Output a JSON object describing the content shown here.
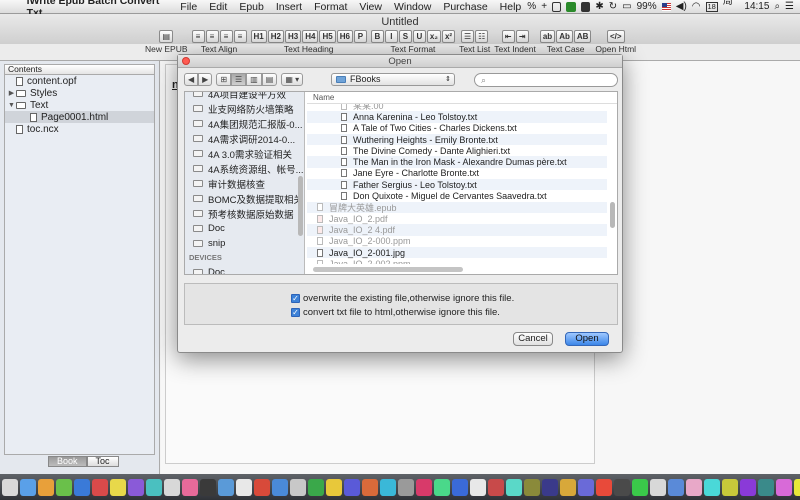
{
  "menubar": {
    "app_name": "iWrite Epub Batch Convert Txt",
    "items": [
      "File",
      "Edit",
      "Epub",
      "Insert",
      "Format",
      "View",
      "Window",
      "Purchase",
      "Help"
    ],
    "battery": "99%",
    "cal_day": "18",
    "weekday": "周一",
    "time": "14:15"
  },
  "window": {
    "title": "Untitled",
    "toolbar": [
      {
        "label": "New EPUB",
        "buttons": [
          "▤"
        ]
      },
      {
        "label": "Text Align",
        "buttons": [
          "≡",
          "≡",
          "≡",
          "≡"
        ]
      },
      {
        "label": "Text Heading",
        "buttons": [
          "H1",
          "H2",
          "H3",
          "H4",
          "H5",
          "H6",
          "P"
        ]
      },
      {
        "label": "Text Format",
        "buttons": [
          "B",
          "I",
          "S",
          "U",
          "x₂",
          "x²"
        ]
      },
      {
        "label": "Text List",
        "buttons": [
          "☰",
          "☷"
        ]
      },
      {
        "label": "Text Indent",
        "buttons": [
          "⇤",
          "⇥"
        ]
      },
      {
        "label": "Text Case",
        "buttons": [
          "ab",
          "Ab",
          "AB"
        ]
      },
      {
        "label": "Open Html",
        "buttons": [
          "</>"
        ]
      }
    ]
  },
  "sidebar": {
    "header": "Contents",
    "items": [
      {
        "label": "content.opf",
        "level": 0,
        "type": "file",
        "expand": ""
      },
      {
        "label": "Styles",
        "level": 0,
        "type": "folder",
        "expand": "▶"
      },
      {
        "label": "Text",
        "level": 0,
        "type": "folder",
        "expand": "▼"
      },
      {
        "label": "Page0001.html",
        "level": 1,
        "type": "file",
        "expand": "",
        "selected": true
      },
      {
        "label": "toc.ncx",
        "level": 0,
        "type": "file",
        "expand": ""
      }
    ],
    "tabs": [
      "Book",
      "Toc"
    ]
  },
  "editor": {
    "visible_text": "ne"
  },
  "dialog": {
    "title": "Open",
    "location": "FBooks",
    "nav_back": "◀",
    "nav_forward": "▶",
    "view_buttons": [
      "⊞",
      "☰",
      "▥",
      "▤"
    ],
    "arrange_button": "▦ ▾",
    "favorites": [
      "4A项目建设平方效",
      "业支网络防火墙策略",
      "4A集团规范汇报版-0...",
      "4A需求调研2014-0...",
      "4A 3.0需求验证相关",
      "4A系统资源组、帐号...",
      "审计数据核查",
      "BOMC及数据提取相关",
      "预考核数据原始数据",
      "Doc",
      "snip"
    ],
    "devices_header": "DEVICES",
    "devices": [
      "Doc"
    ],
    "column_header": "Name",
    "files": [
      {
        "name": "某某.00",
        "indent": true,
        "dim": true
      },
      {
        "name": "Anna Karenina - Leo Tolstoy.txt",
        "indent": true,
        "dim": false
      },
      {
        "name": "A Tale of Two Cities - Charles Dickens.txt",
        "indent": true,
        "dim": false
      },
      {
        "name": "Wuthering Heights - Emily Bronte.txt",
        "indent": true,
        "dim": false
      },
      {
        "name": "The Divine Comedy - Dante Alighieri.txt",
        "indent": true,
        "dim": false
      },
      {
        "name": "The Man in the Iron Mask - Alexandre Dumas père.txt",
        "indent": true,
        "dim": false
      },
      {
        "name": "Jane Eyre - Charlotte Bronte.txt",
        "indent": true,
        "dim": false
      },
      {
        "name": "Father Sergius - Leo Tolstoy.txt",
        "indent": true,
        "dim": false
      },
      {
        "name": "Don Quixote - Miguel de Cervantes Saavedra.txt",
        "indent": true,
        "dim": false
      },
      {
        "name": "冒牌大英雄.epub",
        "indent": false,
        "dim": true
      },
      {
        "name": "Java_IO_2.pdf",
        "indent": false,
        "dim": true,
        "pdf": true
      },
      {
        "name": "Java_IO_2 4.pdf",
        "indent": false,
        "dim": true,
        "pdf": true
      },
      {
        "name": "Java_IO_2-000.ppm",
        "indent": false,
        "dim": true
      },
      {
        "name": "Java_IO_2-001.jpg",
        "indent": false,
        "dim": false
      },
      {
        "name": "Java_IO_2-002.ppm",
        "indent": false,
        "dim": true
      }
    ],
    "options": [
      {
        "label": "overwrite the existing file,otherwise ignore this file.",
        "checked": true
      },
      {
        "label": "convert txt file to html,otherwise ignore this file.",
        "checked": true
      }
    ],
    "cancel_label": "Cancel",
    "open_label": "Open"
  },
  "dock": {
    "icon_colors": [
      "#d8d8d8",
      "#5aa0e8",
      "#e8a03a",
      "#6ac04a",
      "#3a7ad8",
      "#d84a4a",
      "#e8d84a",
      "#8a5ad8",
      "#4ac0c0",
      "#d8d8d8",
      "#e86a9a",
      "#3a3a3a",
      "#5a9ad8",
      "#e8e8e8",
      "#d84a3a",
      "#4a8ad8",
      "#c8c8c8",
      "#3aa84a",
      "#e8c83a",
      "#5a5ad8",
      "#d86a3a",
      "#3ab8d8",
      "#9a9a9a",
      "#d83a6a",
      "#4ad88a",
      "#3a6ad8",
      "#e8e8e8",
      "#c84a4a",
      "#5ad8c8",
      "#8a8a3a",
      "#3a3a8a",
      "#d8a83a",
      "#6a6ad8",
      "#e84a3a",
      "#4a4a4a",
      "#3ac84a",
      "#d8d8d8",
      "#5a8ad8",
      "#e8a8c8",
      "#4ad8d8",
      "#c8c83a",
      "#8a3ad8",
      "#3a8a8a",
      "#d86ad8",
      "#e8e83a",
      "#6a3a3a"
    ]
  }
}
